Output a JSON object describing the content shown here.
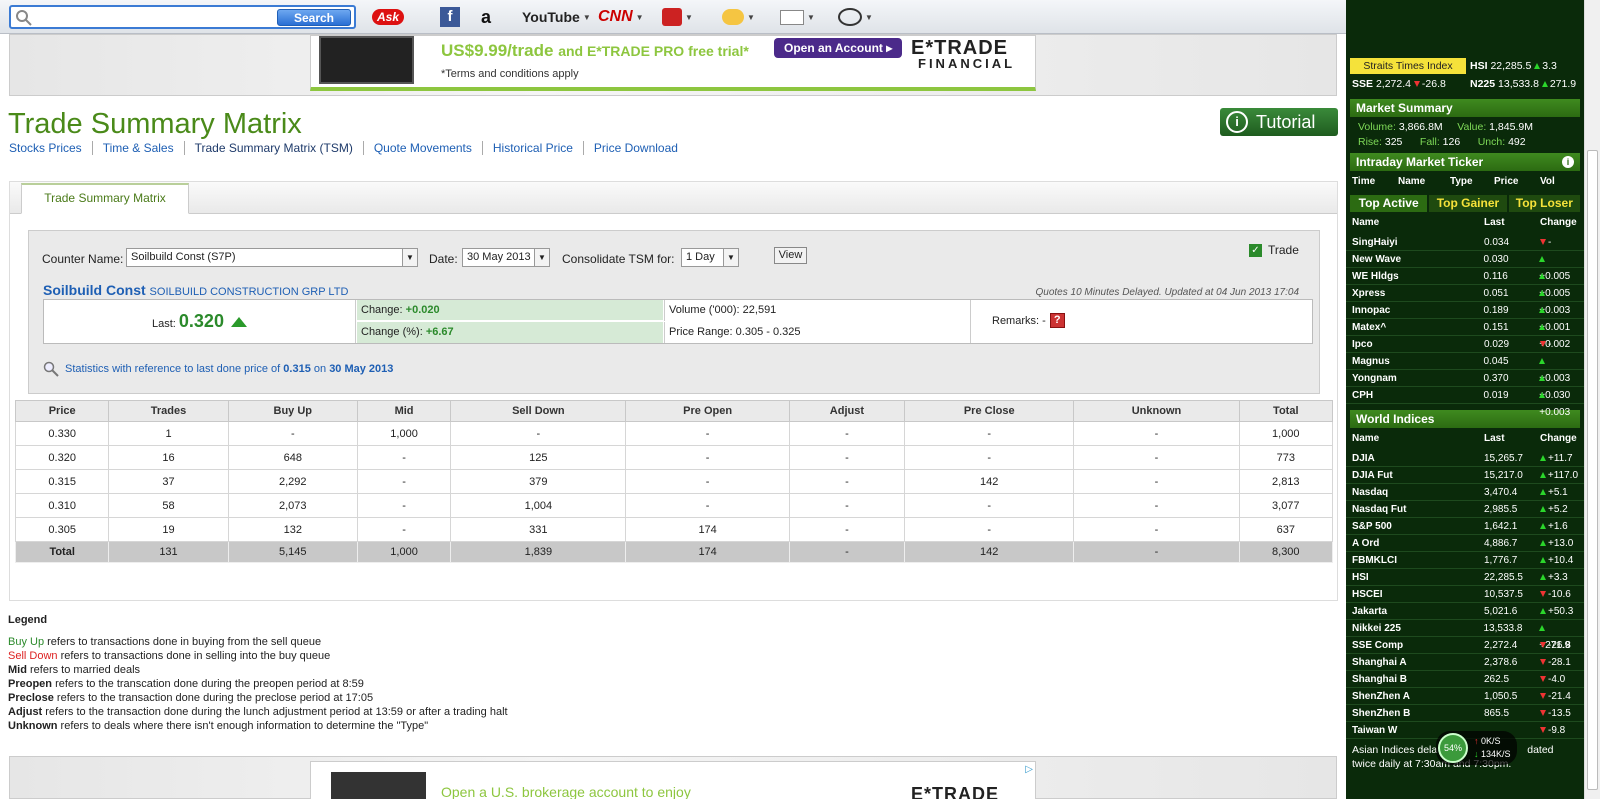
{
  "toolbar": {
    "search_placeholder": "",
    "search_button": "Search",
    "ask": "Ask",
    "youtube": "YouTube",
    "cnn": "CNN"
  },
  "banner": {
    "headline": "US$9.99/trade",
    "headline_rest": "and E*TRADE PRO free trial*",
    "terms": "*Terms and conditions apply",
    "open_account": "Open an Account ▸",
    "brand_top": "E*TRADE",
    "brand_bottom": "FINANCIAL"
  },
  "page": {
    "title": "Trade Summary Matrix",
    "tutorial": "Tutorial",
    "nav": [
      "Stocks Prices",
      "Time & Sales",
      "Trade Summary Matrix (TSM)",
      "Quote Movements",
      "Historical Price",
      "Price Download"
    ],
    "tab": "Trade Summary Matrix"
  },
  "form": {
    "counter_label": "Counter Name:",
    "counter_value": "Soilbuild Const (S7P)",
    "date_label": "Date:",
    "date_value": "30 May 2013",
    "consolidate_label": "Consolidate TSM for:",
    "consolidate_value": "1 Day",
    "view": "View",
    "trade": "Trade"
  },
  "quote": {
    "name": "Soilbuild Const",
    "full_name": "SOILBUILD CONSTRUCTION GRP LTD",
    "delay_note": "Quotes 10 Minutes Delayed. Updated at 04 Jun 2013 17:04",
    "last_label": "Last:",
    "last_value": "0.320",
    "change_label": "Change:",
    "change_value": "+0.020",
    "change_pct_label": "Change (%):",
    "change_pct_value": "+6.67",
    "volume_label": "Volume ('000):",
    "volume_value": "22,591",
    "range_label": "Price Range:",
    "range_value": "0.305 - 0.325",
    "remarks_label": "Remarks: -",
    "remarks_icon": "?"
  },
  "stats": {
    "prefix": "Statistics with reference to last done price of",
    "price": "0.315",
    "on": "on",
    "date": "30 May 2013"
  },
  "table": {
    "headers": [
      "Price",
      "Trades",
      "Buy Up",
      "Mid",
      "Sell Down",
      "Pre Open",
      "Adjust",
      "Pre Close",
      "Unknown",
      "Total"
    ],
    "rows": [
      [
        "0.330",
        "1",
        "-",
        "1,000",
        "-",
        "-",
        "-",
        "-",
        "-",
        "1,000"
      ],
      [
        "0.320",
        "16",
        "648",
        "-",
        "125",
        "-",
        "-",
        "-",
        "-",
        "773"
      ],
      [
        "0.315",
        "37",
        "2,292",
        "-",
        "379",
        "-",
        "-",
        "142",
        "-",
        "2,813"
      ],
      [
        "0.310",
        "58",
        "2,073",
        "-",
        "1,004",
        "-",
        "-",
        "-",
        "-",
        "3,077"
      ],
      [
        "0.305",
        "19",
        "132",
        "-",
        "331",
        "174",
        "-",
        "-",
        "-",
        "637"
      ]
    ],
    "total": [
      "Total",
      "131",
      "5,145",
      "1,000",
      "1,839",
      "174",
      "-",
      "142",
      "-",
      "8,300"
    ]
  },
  "legend": {
    "title": "Legend",
    "items": [
      {
        "term": "Buy Up",
        "desc": " refers to transactions done in buying from the sell queue"
      },
      {
        "term": "Sell Down",
        "desc": " refers to transactions done in selling into the buy queue"
      },
      {
        "term": "Mid",
        "desc": " refers to married deals"
      },
      {
        "term": "Preopen",
        "desc": " refers to the transcation done during the preopen period at 8:59"
      },
      {
        "term": "Preclose",
        "desc": " refers to the transaction done during the preclose period at 17:05"
      },
      {
        "term": "Adjust",
        "desc": " refers to the transaction done during the lunch adjustment period at 13:59 or after a trading halt"
      },
      {
        "term": "Unknown",
        "desc": " refers to deals where there isn't enough information to determine the \"Type\""
      }
    ]
  },
  "bottom_banner": {
    "text": "Open a U.S. brokerage account to enjoy",
    "brand": "E*TRADE"
  },
  "sidebar": {
    "indices_top": {
      "sti": "Straits Times Index",
      "hsi_label": "HSI",
      "hsi_value": "22,285.5",
      "hsi_change": "3.3",
      "sse_label": "SSE",
      "sse_value": "2,272.4",
      "sse_change": "-26.8",
      "n225_label": "N225",
      "n225_value": "13,533.8",
      "n225_change": "271.9"
    },
    "market_summary": {
      "title": "Market Summary",
      "volume_label": "Volume:",
      "volume": "3,866.8M",
      "value_label": "Value:",
      "value": "1,845.9M",
      "rise_label": "Rise:",
      "rise": "325",
      "fall_label": "Fall:",
      "fall": "126",
      "unch_label": "Unch:",
      "unch": "492"
    },
    "ticker": {
      "title": "Intraday Market Ticker",
      "headers": [
        "Time",
        "Name",
        "Type",
        "Price",
        "Vol"
      ]
    },
    "tabs": [
      "Top Active",
      "Top Gainer",
      "Top Loser"
    ],
    "active_headers": [
      "Name",
      "Last",
      "Change"
    ],
    "active": [
      {
        "name": "SingHaiyi",
        "last": "0.034",
        "change": "-",
        "dir": "flat"
      },
      {
        "name": "New Wave",
        "last": "0.030",
        "change": "+0.005",
        "dir": "up"
      },
      {
        "name": "WE Hldgs",
        "last": "0.116",
        "change": "+0.005",
        "dir": "up"
      },
      {
        "name": "Xpress",
        "last": "0.051",
        "change": "+0.003",
        "dir": "up"
      },
      {
        "name": "Innopac",
        "last": "0.189",
        "change": "+0.001",
        "dir": "up"
      },
      {
        "name": "Matex^",
        "last": "0.151",
        "change": "+0.002",
        "dir": "up"
      },
      {
        "name": "Ipco",
        "last": "0.029",
        "change": "-",
        "dir": "flat"
      },
      {
        "name": "Magnus",
        "last": "0.045",
        "change": "+0.003",
        "dir": "up"
      },
      {
        "name": "Yongnam",
        "last": "0.370",
        "change": "+0.030",
        "dir": "up"
      },
      {
        "name": "CPH",
        "last": "0.019",
        "change": "+0.003",
        "dir": "up"
      }
    ],
    "world_title": "World Indices",
    "world_headers": [
      "Name",
      "Last",
      "Change"
    ],
    "world": [
      {
        "name": "DJIA",
        "last": "15,265.7",
        "change": "+11.7",
        "dir": "up"
      },
      {
        "name": "DJIA Fut",
        "last": "15,217.0",
        "change": "+117.0",
        "dir": "up"
      },
      {
        "name": "Nasdaq",
        "last": "3,470.4",
        "change": "+5.1",
        "dir": "up"
      },
      {
        "name": "Nasdaq Fut",
        "last": "2,985.5",
        "change": "+5.2",
        "dir": "up"
      },
      {
        "name": "S&P 500",
        "last": "1,642.1",
        "change": "+1.6",
        "dir": "up"
      },
      {
        "name": "A Ord",
        "last": "4,886.7",
        "change": "+13.0",
        "dir": "up"
      },
      {
        "name": "FBMKLCI",
        "last": "1,776.7",
        "change": "+10.4",
        "dir": "up"
      },
      {
        "name": "HSI",
        "last": "22,285.5",
        "change": "+3.3",
        "dir": "up"
      },
      {
        "name": "HSCEI",
        "last": "10,537.5",
        "change": "-10.6",
        "dir": "down"
      },
      {
        "name": "Jakarta",
        "last": "5,021.6",
        "change": "+50.3",
        "dir": "up"
      },
      {
        "name": "Nikkei 225",
        "last": "13,533.8",
        "change": "+271.9",
        "dir": "up"
      },
      {
        "name": "SSE Comp",
        "last": "2,272.4",
        "change": "-26.8",
        "dir": "down"
      },
      {
        "name": "Shanghai A",
        "last": "2,378.6",
        "change": "-28.1",
        "dir": "down"
      },
      {
        "name": "Shanghai B",
        "last": "262.5",
        "change": "-4.0",
        "dir": "down"
      },
      {
        "name": "ShenZhen A",
        "last": "1,050.5",
        "change": "-21.4",
        "dir": "down"
      },
      {
        "name": "ShenZhen B",
        "last": "865.5",
        "change": "-13.5",
        "dir": "down"
      },
      {
        "name": "Taiwan W",
        "last": "",
        "change": "-9.8",
        "dir": "down"
      }
    ],
    "footnote_1": "Asian Indices dela",
    "footnote_1b": "dated",
    "footnote_2": "twice daily at 7:30am and 7:30pm.",
    "net_pct": "54%",
    "net_up": "0K/S",
    "net_down": "134K/S"
  }
}
